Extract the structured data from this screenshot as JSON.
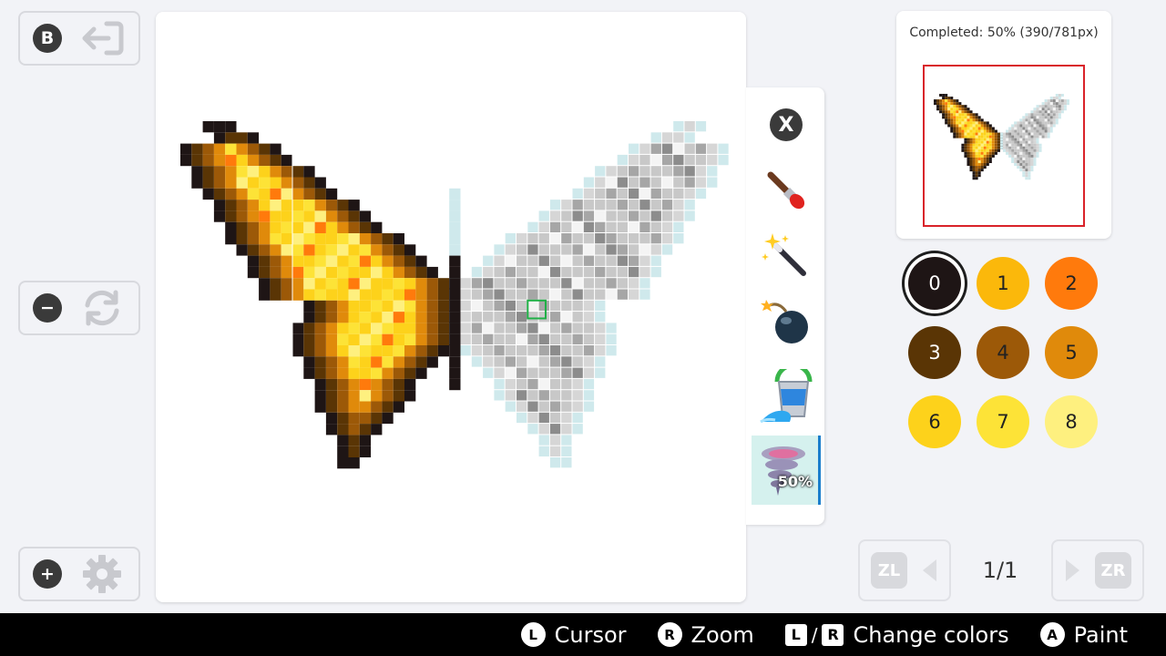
{
  "left_controls": {
    "back": {
      "badge": "B",
      "icon": "exit-arrow-icon"
    },
    "reset": {
      "badge": "−",
      "icon": "refresh-icon"
    },
    "settings": {
      "badge": "+",
      "icon": "gear-icon"
    }
  },
  "tools": [
    {
      "name": "close",
      "badge": "X"
    },
    {
      "name": "brush",
      "icon": "paintbrush-icon"
    },
    {
      "name": "magic-wand",
      "icon": "magic-wand-icon"
    },
    {
      "name": "bomb",
      "icon": "bomb-icon"
    },
    {
      "name": "paint-bucket",
      "icon": "paint-bucket-icon"
    },
    {
      "name": "tornado",
      "icon": "tornado-icon",
      "badge": "50%",
      "active": true
    }
  ],
  "preview": {
    "completed_text": "Completed: 50% (390/781px)",
    "completed_fraction": 0.5
  },
  "palette": {
    "selected": 0,
    "colors": [
      {
        "label": "0",
        "hex": "#1e1515",
        "text": "#ffffff"
      },
      {
        "label": "1",
        "hex": "#fbb80b",
        "text": "#222222"
      },
      {
        "label": "2",
        "hex": "#ff7a0c",
        "text": "#222222"
      },
      {
        "label": "3",
        "hex": "#5a3505",
        "text": "#ffffff"
      },
      {
        "label": "4",
        "hex": "#9c5908",
        "text": "#222222"
      },
      {
        "label": "5",
        "hex": "#e08a0b",
        "text": "#222222"
      },
      {
        "label": "6",
        "hex": "#fdd21b",
        "text": "#222222"
      },
      {
        "label": "7",
        "hex": "#fde337",
        "text": "#222222"
      },
      {
        "label": "8",
        "hex": "#fef07f",
        "text": "#222222"
      }
    ]
  },
  "pagination": {
    "prev_button": "ZL",
    "next_button": "ZR",
    "indicator": "1/1"
  },
  "footer": {
    "cursor": {
      "icon": "L",
      "label": "Cursor"
    },
    "zoom": {
      "icon": "R",
      "label": "Zoom"
    },
    "change": {
      "key1": "L",
      "sep": "/",
      "key2": "R",
      "label": "Change colors"
    },
    "paint": {
      "icon": "A",
      "label": "Paint"
    }
  }
}
